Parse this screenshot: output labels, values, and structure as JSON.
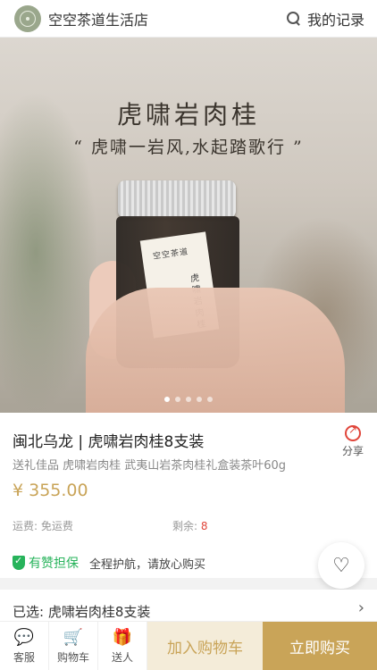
{
  "header": {
    "store_name": "空空茶道生活店",
    "records_label": "我的记录"
  },
  "hero": {
    "title": "虎啸岩肉桂",
    "quote": "“ 虎啸一岩风,水起踏歌行 ”",
    "label_top": "空空茶道",
    "label_side": "虎啸岩肉桂",
    "slides": 5,
    "active_slide": 1
  },
  "product": {
    "title": "闽北乌龙 | 虎啸岩肉桂8支装",
    "subtitle": "送礼佳品 虎啸岩肉桂 武夷山岩茶肉桂礼盒装茶叶60g",
    "price": "¥ 355.00",
    "shipping": "运费: 免运费",
    "stock_label": "剩余: ",
    "stock_value": "8",
    "share_label": "分享"
  },
  "guarantee": {
    "brand": "有赞担保",
    "text": "全程护航，请放心购买"
  },
  "selection": {
    "text": "已选: 虎啸岩肉桂8支装",
    "arrow": "›"
  },
  "bottom_bar": {
    "service_label": "客服",
    "cart_label": "购物车",
    "gift_label": "送人",
    "add_to_cart_label": "加入购物车",
    "buy_now_label": "立即购买"
  },
  "colors": {
    "accent_gold": "#c9a458",
    "accent_light": "#f4ecd9",
    "guarantee_green": "#27b35b",
    "alert_red": "#e0453a"
  },
  "icons": [
    "search-icon",
    "share-icon",
    "shield-icon",
    "heart-icon",
    "chat-icon",
    "cart-icon",
    "gift-icon",
    "chevron-right-icon"
  ]
}
